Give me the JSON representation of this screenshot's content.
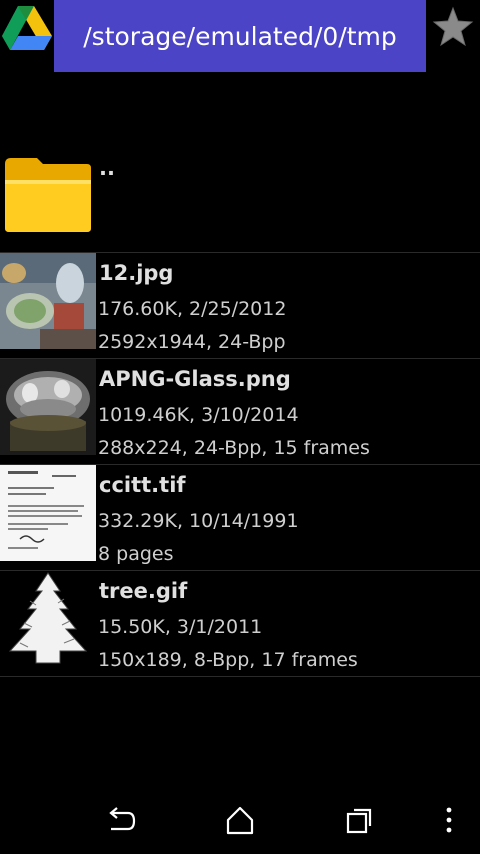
{
  "header": {
    "path": "/storage/emulated/0/tmp",
    "drive_icon": "google-drive-icon",
    "star_icon": "star-icon"
  },
  "parent": {
    "label": ".."
  },
  "files": [
    {
      "name": "12.jpg",
      "meta1": "176.60K, 2/25/2012",
      "meta2": "2592x1944, 24-Bpp"
    },
    {
      "name": "APNG-Glass.png",
      "meta1": "1019.46K, 3/10/2014",
      "meta2": "288x224, 24-Bpp, 15 frames"
    },
    {
      "name": "ccitt.tif",
      "meta1": "332.29K, 10/14/1991",
      "meta2": "8 pages"
    },
    {
      "name": "tree.gif",
      "meta1": "15.50K, 3/1/2011",
      "meta2": "150x189, 8-Bpp, 17 frames"
    }
  ],
  "navbar": {
    "back_icon": "back-icon",
    "home_icon": "home-icon",
    "recents_icon": "recents-icon",
    "menu_icon": "overflow-menu-icon"
  },
  "colors": {
    "path_bar": "#4b44c6",
    "background": "#000000"
  }
}
